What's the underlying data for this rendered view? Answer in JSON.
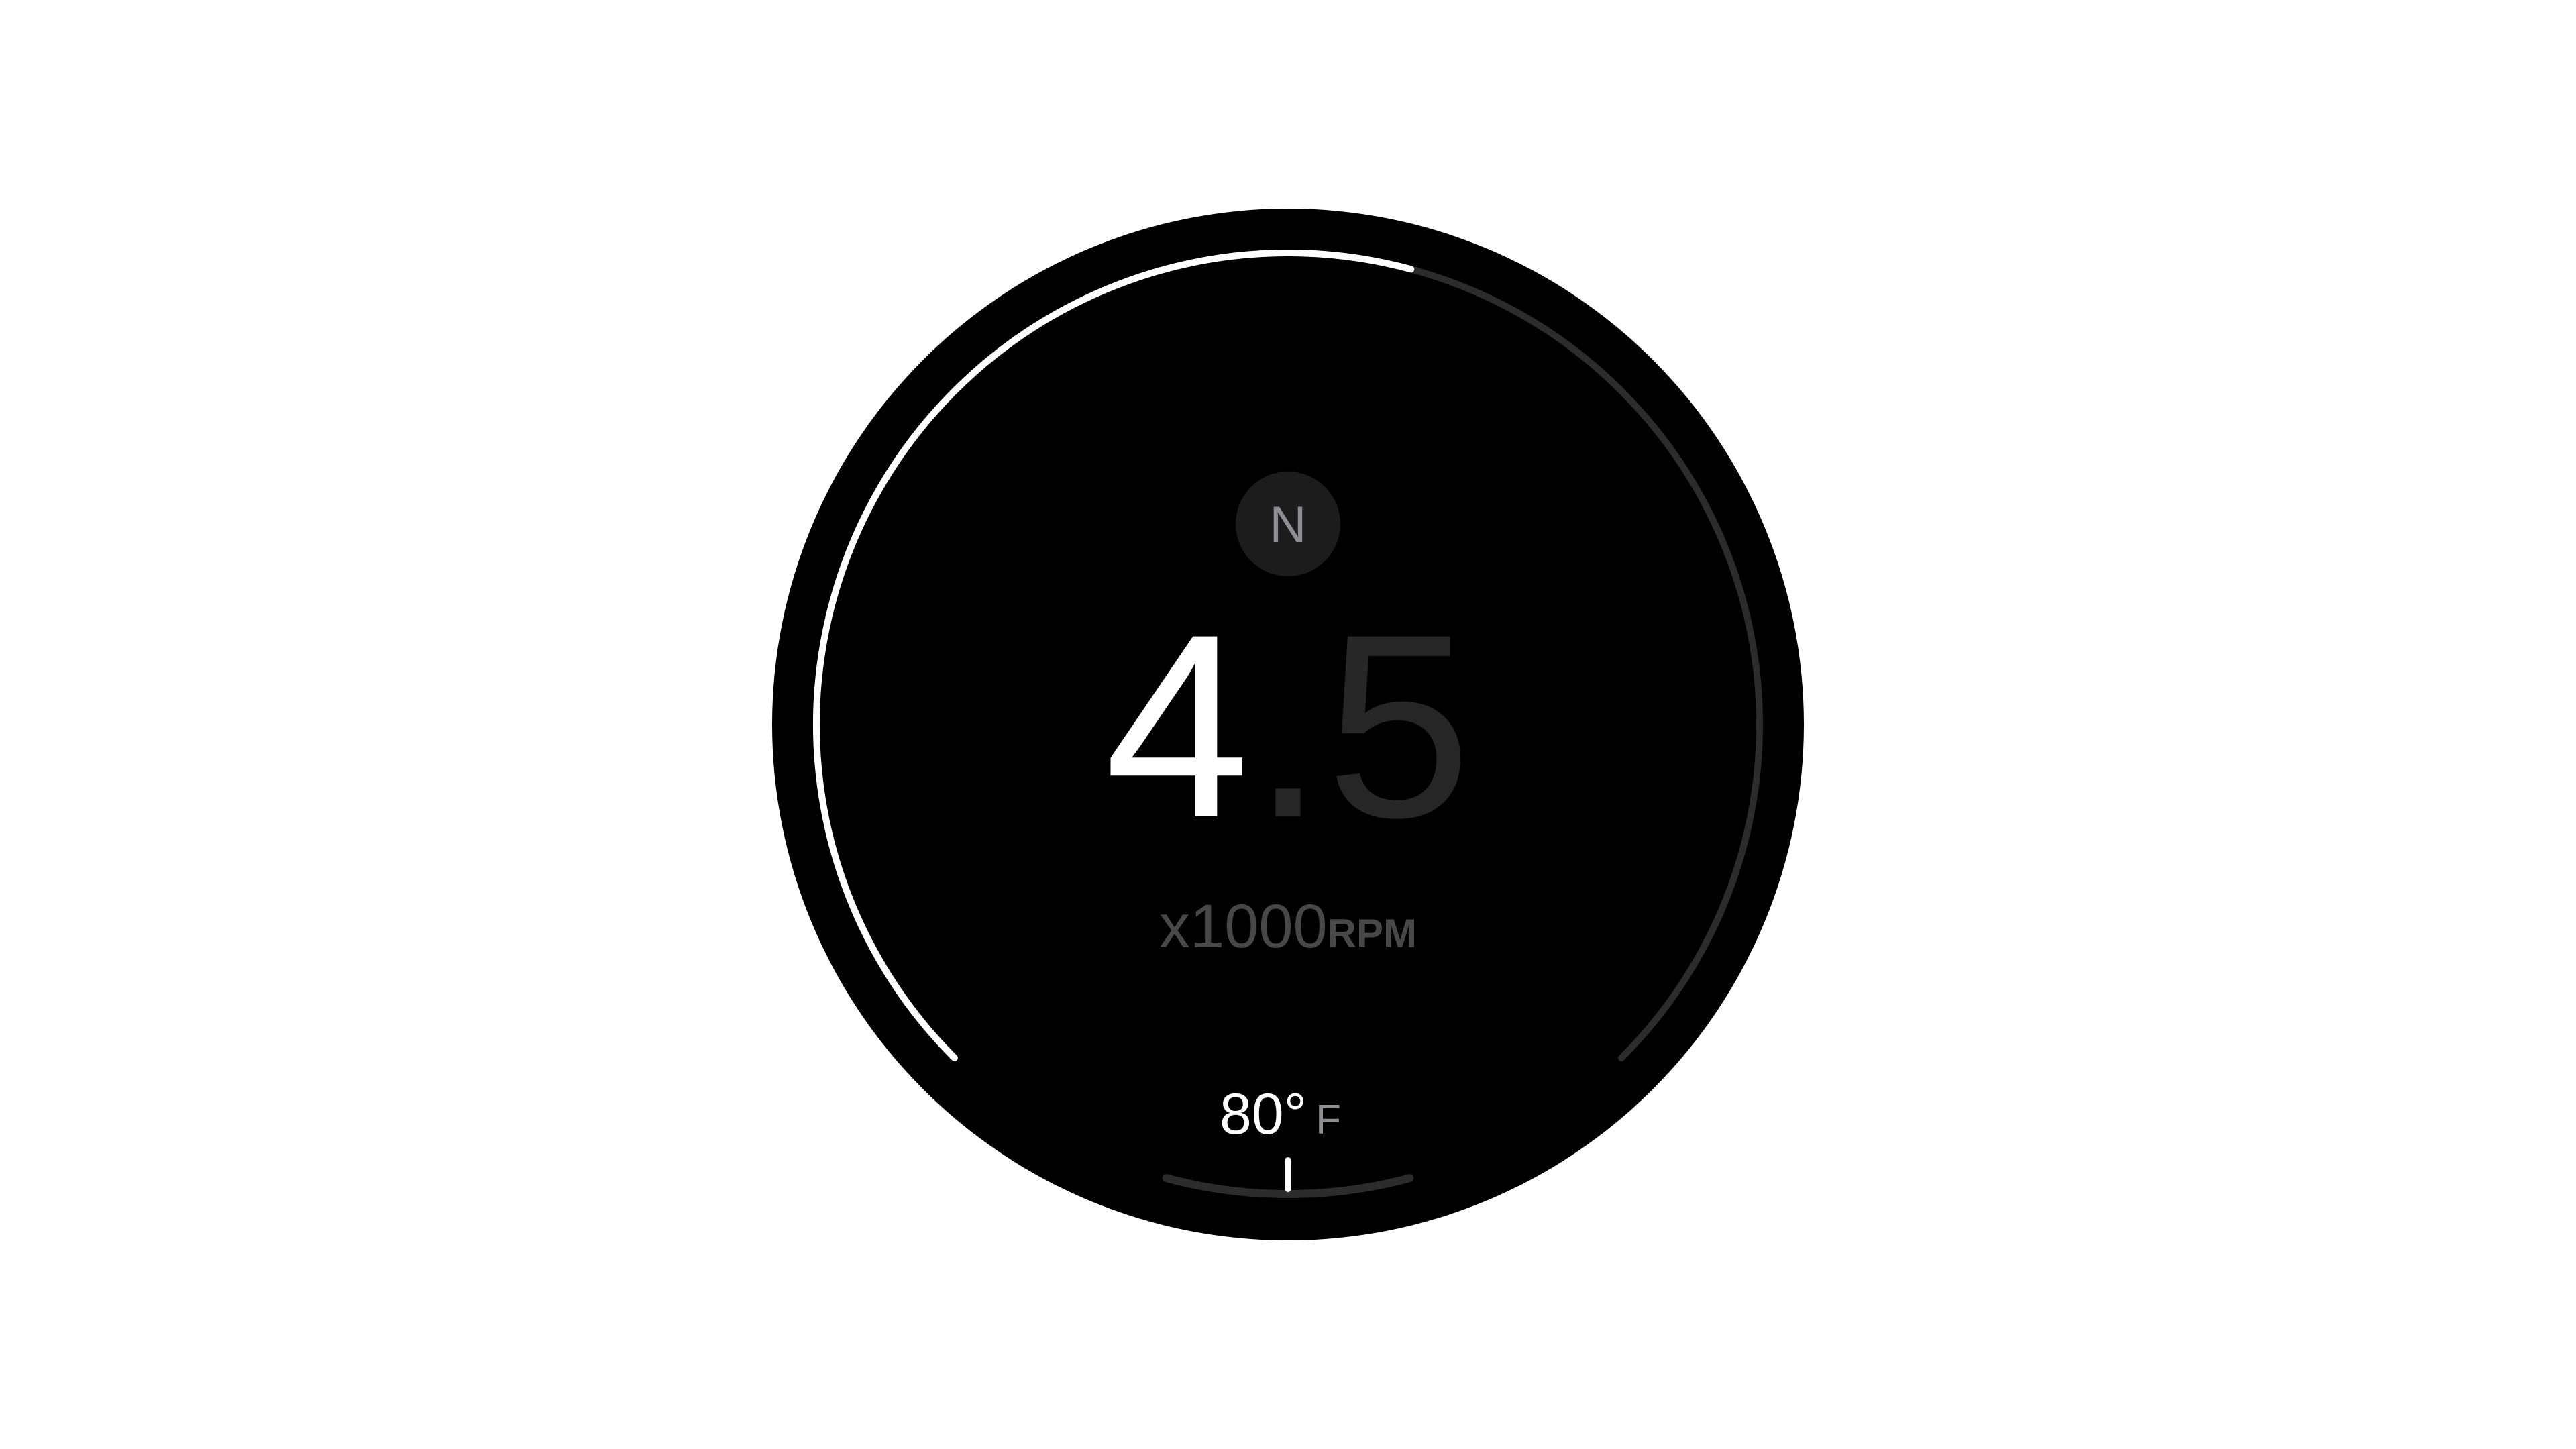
{
  "gauge": {
    "gear": "N",
    "rpm": {
      "integer": "4",
      "separator": ".",
      "fraction": "5"
    },
    "rpm_unit_multiplier": "x1000",
    "rpm_unit": "RPM",
    "rpm_gauge_fill_fraction": 0.556,
    "temperature": "80°",
    "temperature_unit": "F",
    "temperature_gauge_fraction": 0.5
  },
  "colors": {
    "background": "#ffffff",
    "dial": "#000000",
    "active": "#ffffff",
    "track": "#2c2c2e",
    "gear_badge": "#1c1c1e",
    "secondary_text": "#8e8e93",
    "unit_text": "#48484a",
    "dim_digits": "#262626"
  }
}
